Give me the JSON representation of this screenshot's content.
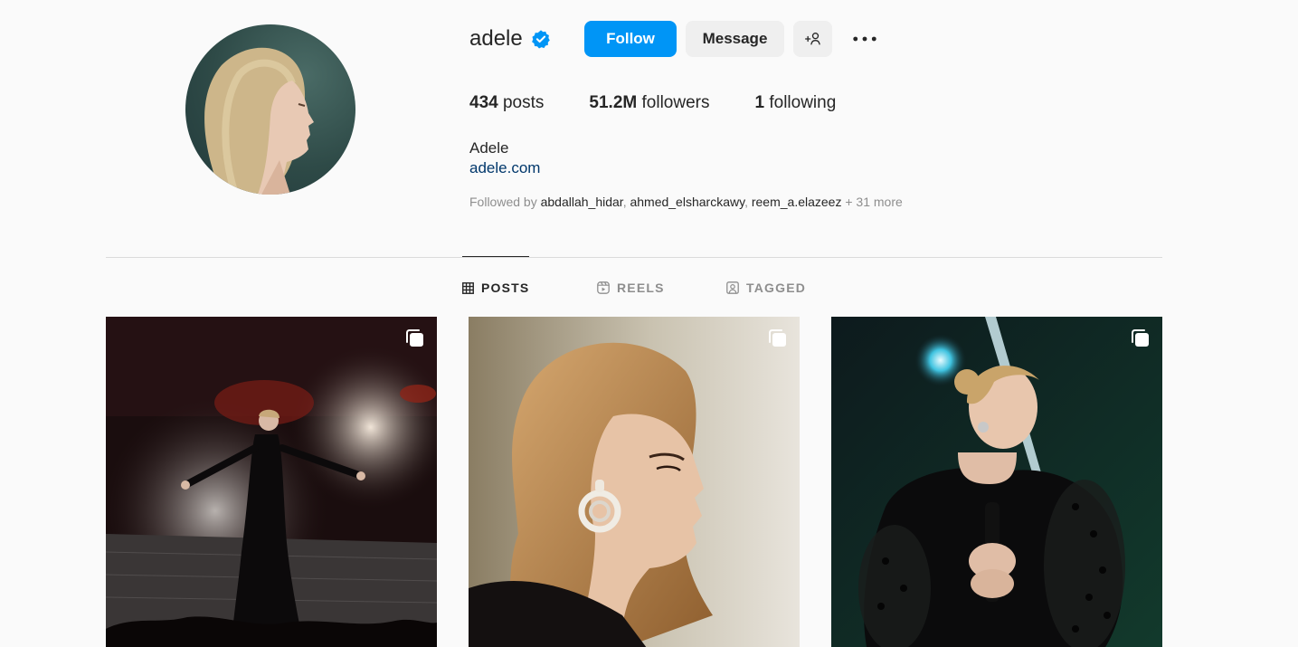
{
  "profile": {
    "username": "adele",
    "verified": true,
    "full_name": "Adele",
    "website": "adele.com",
    "avatar_icon": "profile-photo"
  },
  "actions": {
    "follow_label": "Follow",
    "message_label": "Message",
    "suggest_icon": "add-person-icon",
    "more_icon": "more-options-icon"
  },
  "stats": {
    "posts_count": "434",
    "posts_label": "posts",
    "followers_count": "51.2M",
    "followers_label": "followers",
    "following_count": "1",
    "following_label": "following"
  },
  "followed_by": {
    "prefix": "Followed by",
    "names": [
      "abdallah_hidar",
      "ahmed_elsharckawy",
      "reem_a.elazeez"
    ],
    "suffix": "+ 31 more"
  },
  "tabs": [
    {
      "label": "POSTS",
      "icon": "grid-icon",
      "active": true
    },
    {
      "label": "REELS",
      "icon": "reels-icon",
      "active": false
    },
    {
      "label": "TAGGED",
      "icon": "tagged-icon",
      "active": false
    }
  ],
  "posts": [
    {
      "type": "carousel",
      "icon": "carousel-icon"
    },
    {
      "type": "carousel",
      "icon": "carousel-icon"
    },
    {
      "type": "carousel",
      "icon": "carousel-icon"
    }
  ],
  "colors": {
    "primary_button": "#0095f6",
    "secondary_button": "#efefef",
    "link": "#00376b",
    "muted_text": "#8e8e8e",
    "text": "#262626",
    "verified_badge": "#0095f6",
    "background": "#fafafa"
  }
}
